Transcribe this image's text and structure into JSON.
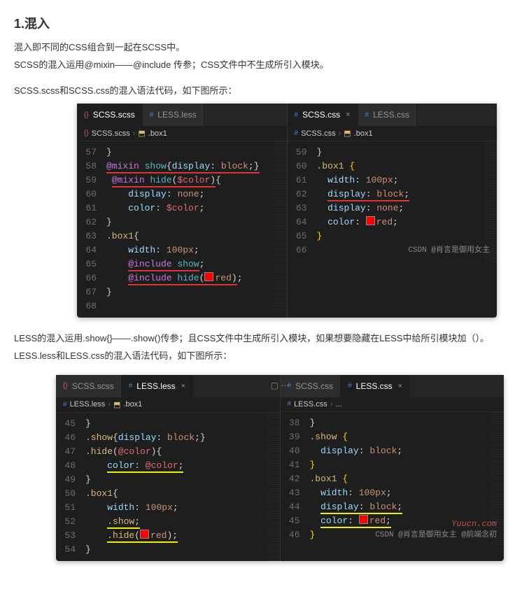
{
  "heading": "1.混入",
  "intro1": "混入即不同的CSS组合到一起在SCSS中。",
  "intro2": "SCSS的混入运用@mixin——@include 传参；CSS文件中不生成所引入模块。",
  "caption1": "SCSS.scss和SCSS.css的混入语法代码，如下图所示：",
  "editor1": {
    "left": {
      "tabs": [
        {
          "icon": "ico-scss",
          "label": "SCSS.scss",
          "active": true,
          "close": false
        },
        {
          "icon": "ico-less",
          "label": "LESS.less",
          "active": false,
          "close": false
        }
      ],
      "breadcrumb": {
        "file": "SCSS.scss",
        "fileIcon": "ico-scss",
        "sym": ".box1"
      },
      "lines": [
        {
          "n": "57",
          "h": "}"
        },
        {
          "n": "58",
          "h": "<span class='ul-red'><span class='kw'>@mixin</span> <span class='fn'>show</span>{<span class='prop'>display</span>: <span class='val'>block</span>;}</span>"
        },
        {
          "n": "59",
          "h": " <span class='ul-red'><span class='kw'>@mixin</span> <span class='fn'>hide</span>(<span class='var'>$color</span>)</span>{"
        },
        {
          "n": "60",
          "h": "    <span class='prop'>display</span>: <span class='val'>none</span>;"
        },
        {
          "n": "61",
          "h": "    <span class='prop'>color</span>: <span class='var'>$color</span>;"
        },
        {
          "n": "62",
          "h": "}"
        },
        {
          "n": "63",
          "h": "<span class='sel'>.box1</span>{"
        },
        {
          "n": "64",
          "h": "    <span class='prop'>width</span>: <span class='val'>100px</span>;"
        },
        {
          "n": "65",
          "h": "    <span class='ul-red'><span class='kw'>@include</span> <span class='fn'>show</span></span>;"
        },
        {
          "n": "66",
          "h": "    <span class='ul-red'><span class='kw'>@include</span> <span class='fn'>hide</span>(<span class='sw'></span><span class='val'>red</span>)</span>;"
        },
        {
          "n": "67",
          "h": "}"
        },
        {
          "n": "68",
          "h": ""
        }
      ]
    },
    "right": {
      "tabs": [
        {
          "icon": "ico-css",
          "label": "SCSS.css",
          "active": true,
          "close": true
        },
        {
          "icon": "ico-css",
          "label": "LESS.css",
          "active": false,
          "close": false
        }
      ],
      "breadcrumb": {
        "file": "SCSS.css",
        "fileIcon": "ico-css",
        "sym": ".box1"
      },
      "lines": [
        {
          "n": "59",
          "h": "}"
        },
        {
          "n": "60",
          "h": "<span class='sel'>.box1</span> <span class='br'>{</span>"
        },
        {
          "n": "61",
          "h": "  <span class='prop'>width</span>: <span class='val'>100px</span>;"
        },
        {
          "n": "62",
          "h": "  <span class='ul-red'><span class='prop'>display</span>: <span class='val'>block</span>;</span>"
        },
        {
          "n": "63",
          "h": "  <span class='prop'>display</span>: <span class='val'>none</span>;"
        },
        {
          "n": "64",
          "h": "  <span class='prop'>color</span>: <span class='sw'></span><span class='val'>red</span>;"
        },
        {
          "n": "65",
          "h": "<span class='br'>}</span>"
        },
        {
          "n": "66",
          "h": ""
        }
      ],
      "watermark": "CSDN @肖言是御用女主"
    }
  },
  "intro3": "LESS的混入运用.show{}——.show()传参；且CSS文件中生成所引入模块，如果想要隐藏在LESS中给所引模块加（）。",
  "caption2": "LESS.less和LESS.css的混入语法代码，如下图所示：",
  "editor2": {
    "left": {
      "tabs": [
        {
          "icon": "ico-scss",
          "label": "SCSS.scss",
          "active": false,
          "close": false
        },
        {
          "icon": "ico-less",
          "label": "LESS.less",
          "active": true,
          "close": true
        }
      ],
      "breadcrumb": {
        "file": "LESS.less",
        "fileIcon": "ico-less",
        "sym": ".box1"
      },
      "lines": [
        {
          "n": "45",
          "h": "}"
        },
        {
          "n": "46",
          "h": "<span class='sel'>.show</span>{<span class='prop'>display</span>: <span class='val'>block</span>;}"
        },
        {
          "n": "47",
          "h": "<span class='sel'>.hide</span>(<span class='var'>@color</span>){"
        },
        {
          "n": "48",
          "h": "    <span class='ul-yel'><span class='prop'>color</span>: <span class='var'>@color</span>;</span>"
        },
        {
          "n": "49",
          "h": "}"
        },
        {
          "n": "50",
          "h": "<span class='sel'>.box1</span>{"
        },
        {
          "n": "51",
          "h": "    <span class='prop'>width</span>: <span class='val'>100px</span>;"
        },
        {
          "n": "52",
          "h": "    <span class='ul-yel'><span class='sel'>.show</span>;</span>"
        },
        {
          "n": "53",
          "h": "    <span class='ul-yel'><span class='sel'>.hide</span>(<span class='sw'></span><span class='val'>red</span>);</span>"
        },
        {
          "n": "54",
          "h": "}"
        }
      ]
    },
    "right": {
      "tabs": [
        {
          "icon": "ico-css",
          "label": "SCSS.css",
          "active": false,
          "close": false
        },
        {
          "icon": "ico-css",
          "label": "LESS.css",
          "active": true,
          "close": true
        }
      ],
      "breadcrumb": {
        "file": "LESS.css",
        "fileIcon": "ico-css",
        "sym": "...",
        "nosym": true
      },
      "lines": [
        {
          "n": "38",
          "h": "}"
        },
        {
          "n": "39",
          "h": "<span class='sel'>.show</span> <span class='br'>{</span>"
        },
        {
          "n": "40",
          "h": "  <span class='prop'>display</span>: <span class='val'>block</span>;"
        },
        {
          "n": "41",
          "h": "<span class='br'>}</span>"
        },
        {
          "n": "42",
          "h": "<span class='sel'>.box1</span> <span class='br'>{</span>"
        },
        {
          "n": "43",
          "h": "  <span class='prop'>width</span>: <span class='val'>100px</span>;"
        },
        {
          "n": "44",
          "h": "  <span class='ul-yel'><span class='prop'>display</span>: <span class='val'>block</span>;</span>"
        },
        {
          "n": "45",
          "h": "  <span class='ul-yel'><span class='prop'>color</span>: <span class='sw'></span><span class='val'>red</span>;</span>"
        },
        {
          "n": "46",
          "h": "<span class='br'>}</span>"
        }
      ],
      "wm1": "Yuucn.com",
      "wm2": "CSDN @肖言是御用女主   @前端念初"
    }
  },
  "splitIcon": "▢ ⋯"
}
